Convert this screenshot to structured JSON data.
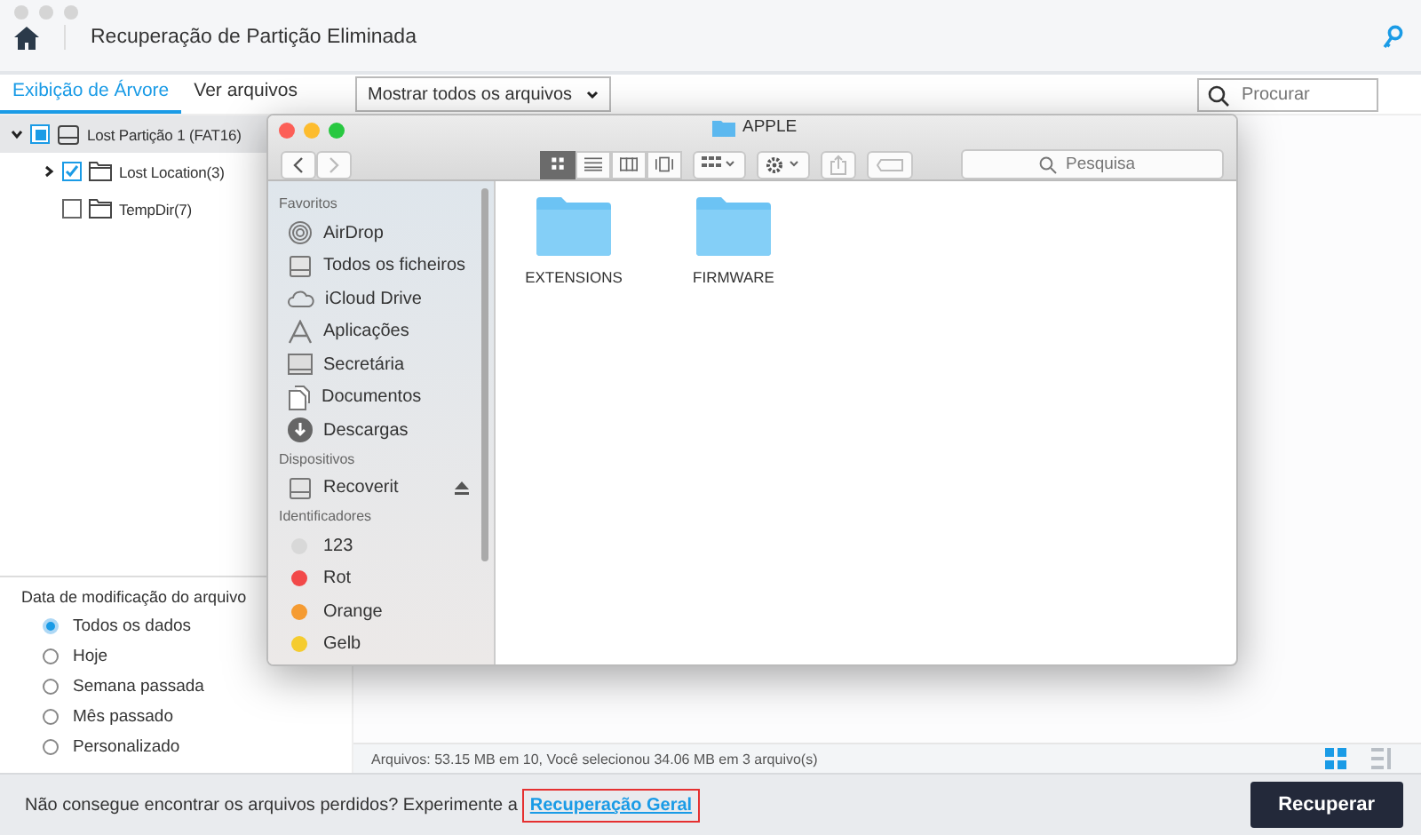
{
  "window": {
    "title": "Recuperação de Partição Eliminada"
  },
  "tabs": [
    {
      "label": "Exibição de Árvore",
      "selected": true
    },
    {
      "label": "Ver arquivos",
      "selected": false
    }
  ],
  "filter_dropdown": {
    "value": "Mostrar todos os arquivos"
  },
  "search": {
    "placeholder": "Procurar"
  },
  "tree": [
    {
      "label": "Lost Partição 1 (FAT16)",
      "partial": true,
      "expanded": true,
      "selected": true,
      "children": [
        {
          "label": "Lost Location(3)",
          "checked": true,
          "partial": false,
          "expanded": false,
          "selected": false
        },
        {
          "label": "TempDir(7)",
          "checked": false,
          "partial": false,
          "selected": false
        }
      ]
    }
  ],
  "date_filter": {
    "title": "Data de modificação do arquivo",
    "options": [
      {
        "label": "Todos os dados",
        "selected": true
      },
      {
        "label": "Hoje",
        "selected": false
      },
      {
        "label": "Semana passada",
        "selected": false
      },
      {
        "label": "Mês passado",
        "selected": false
      },
      {
        "label": "Personalizado",
        "selected": false
      }
    ]
  },
  "finder": {
    "title": "APPLE",
    "view_modes": [
      {
        "selected": true
      },
      {
        "selected": false
      },
      {
        "selected": false
      },
      {
        "selected": false
      }
    ],
    "search": {
      "placeholder": "Pesquisa"
    },
    "sidebar": [
      {
        "heading": "Favoritos",
        "items": [
          {
            "label": "AirDrop",
            "kind": "airdrop"
          },
          {
            "label": "Todos os ficheiros",
            "kind": "files"
          },
          {
            "label": "iCloud Drive",
            "kind": "cloud"
          },
          {
            "label": "Aplicações",
            "kind": "apps"
          },
          {
            "label": "Secretária",
            "kind": "desktop"
          },
          {
            "label": "Documentos",
            "kind": "documents"
          },
          {
            "label": "Descargas",
            "kind": "downloads"
          }
        ]
      },
      {
        "heading": "Dispositivos",
        "items": [
          {
            "label": "Recoverit",
            "kind": "drive",
            "eject": true
          }
        ]
      },
      {
        "heading": "Identificadores",
        "items": [
          {
            "label": "123",
            "kind": "tag",
            "color": "#d8d8d8"
          },
          {
            "label": "Rot",
            "kind": "tag",
            "color": "#f24949"
          },
          {
            "label": "Orange",
            "kind": "tag",
            "color": "#f59b32"
          },
          {
            "label": "Gelb",
            "kind": "tag",
            "color": "#f5cc2f"
          }
        ]
      }
    ],
    "items": [
      {
        "label": "EXTENSIONS"
      },
      {
        "label": "FIRMWARE"
      }
    ]
  },
  "status_bar": {
    "text": "Arquivos: 53.15 MB em 10, Você selecionou 34.06 MB em 3 arquivo(s)",
    "views": [
      {
        "selected": true
      },
      {
        "selected": false
      }
    ]
  },
  "footer": {
    "text": "Não consegue encontrar os arquivos perdidos? Experimente a",
    "link": "Recuperação Geral",
    "button": "Recuperar"
  }
}
